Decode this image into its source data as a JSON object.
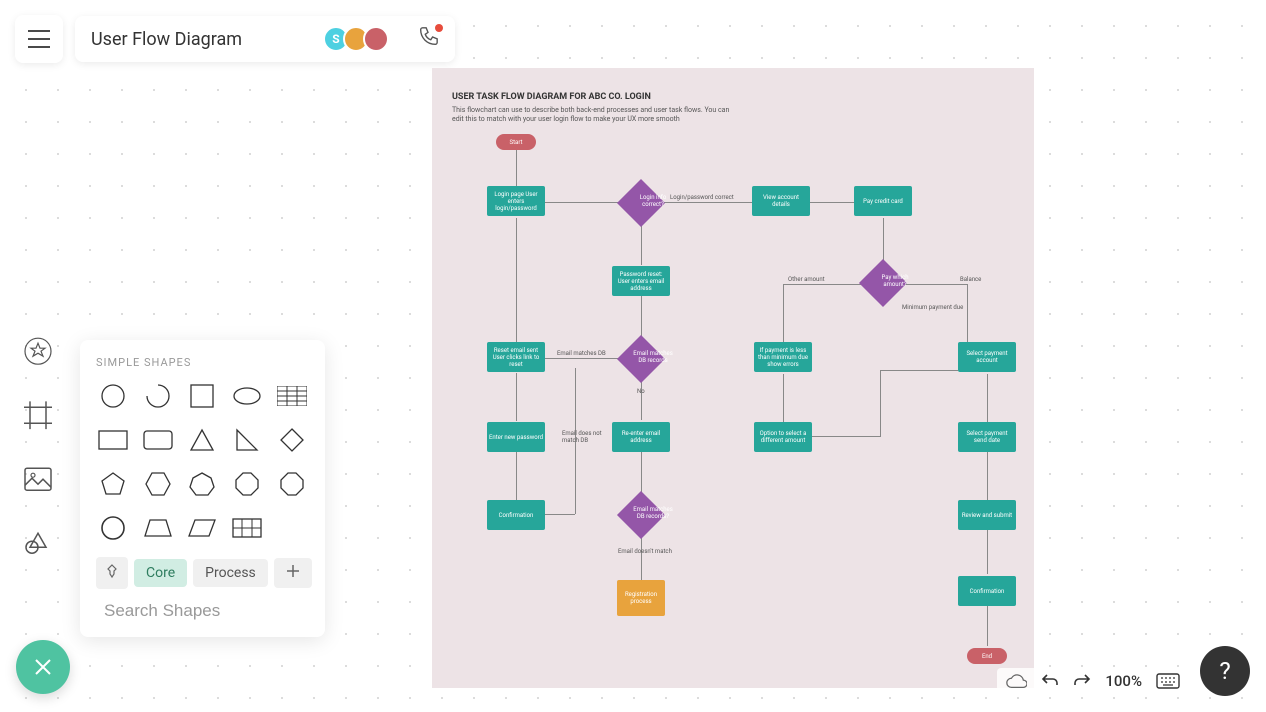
{
  "header": {
    "title": "User Flow Diagram",
    "avatar_s": "S",
    "avatar_colors": [
      "#4dd0e1",
      "#e8a33d",
      "#c96168"
    ]
  },
  "shapes_panel": {
    "label": "SIMPLE SHAPES",
    "tabs": {
      "core": "Core",
      "process": "Process"
    },
    "search_placeholder": "Search Shapes"
  },
  "canvas": {
    "title": "USER TASK FLOW DIAGRAM FOR ABC CO. LOGIN",
    "subtitle": "This flowchart can use to describe both back-end processes and user task flows. You can edit this to match with your user login flow to make your UX more smooth",
    "nodes": {
      "start": "Start",
      "login_page": "Login page User enters login/password",
      "login_match": "Login info correct?",
      "login_ok": "Login/password correct",
      "view_account": "View account details",
      "pay_card": "Pay credit card",
      "password_reset": "Password reset: User enters email address",
      "email_match": "Email matches DB records",
      "email_match_label": "Email matches DB",
      "pay_which": "Pay which amount?",
      "other_amount": "Other amount",
      "balance": "Balance",
      "min_pay": "Minimum payment due",
      "reset_sent": "Reset email sent User clicks link to reset",
      "if_payment": "If payment is less than minimum due show errors",
      "select_source": "Select payment account",
      "enter_pw": "Enter new password",
      "no_label": "No",
      "email_no_match": "Email does not match DB",
      "reenter_email": "Re-enter email address",
      "option_select": "Option to select a different amount",
      "select_date": "Select payment send date",
      "confirmation": "Confirmation",
      "email_match2": "Email matches DB records?",
      "email_no_match2": "Email doesn't match",
      "registration": "Registration process",
      "review": "Review and submit",
      "confirm2": "Confirmation",
      "end": "End"
    }
  },
  "bottom": {
    "zoom": "100%"
  }
}
